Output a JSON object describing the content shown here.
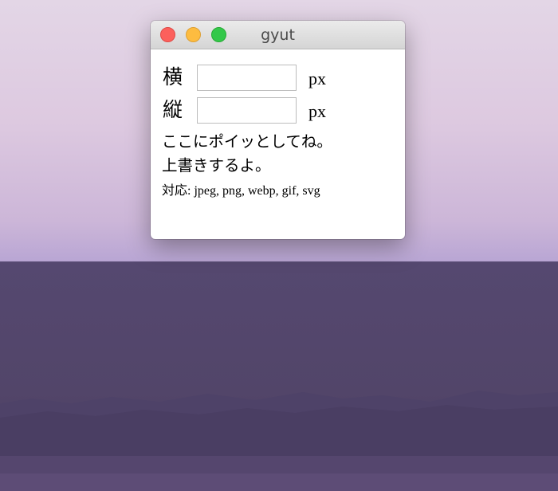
{
  "window": {
    "title": "gyut"
  },
  "form": {
    "width": {
      "label": "横",
      "value": "",
      "unit": "px"
    },
    "height": {
      "label": "縦",
      "value": "",
      "unit": "px"
    }
  },
  "messages": {
    "drop_hint": "ここにポイッとしてね。",
    "overwrite_note": "上書きするよ。",
    "supported_formats": "対応: jpeg, png, webp, gif, svg"
  },
  "colors": {
    "close": "#fc605c",
    "minimize": "#fdbc40",
    "zoom": "#34c84a"
  }
}
